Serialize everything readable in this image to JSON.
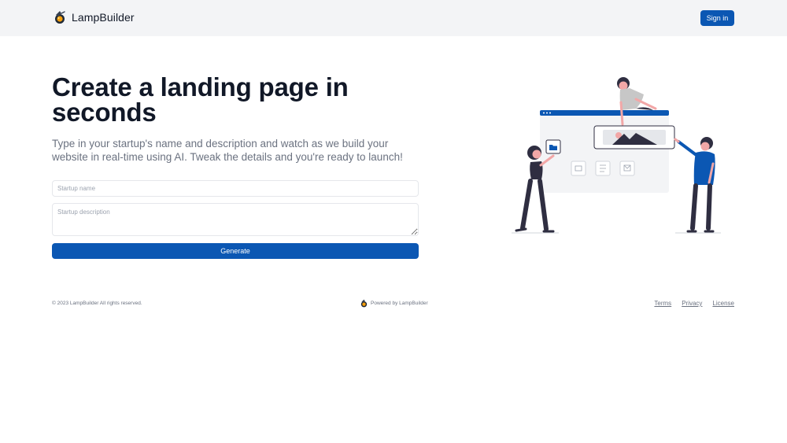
{
  "header": {
    "brand_name": "LampBuilder",
    "signin_label": "Sign in"
  },
  "hero": {
    "title": "Create a landing page in seconds",
    "subtitle": "Type in your startup's name and description and watch as we build your website in real-time using AI. Tweak the details and you're ready to launch!"
  },
  "form": {
    "name_placeholder": "Startup name",
    "description_placeholder": "Startup description",
    "generate_label": "Generate"
  },
  "footer": {
    "copyright": "© 2023 LampBuilder All rights reserved.",
    "powered_by": "Powered by LampBuilder",
    "links": [
      "Terms",
      "Privacy",
      "License"
    ]
  },
  "colors": {
    "accent": "#0b57b3",
    "header_bg": "#f3f4f6",
    "illustration_dark": "#2f2e41",
    "illustration_pink": "#f2a7a7"
  },
  "icons": {
    "brand": "lamp-logo-icon",
    "illustration": "building-website-illustration"
  }
}
